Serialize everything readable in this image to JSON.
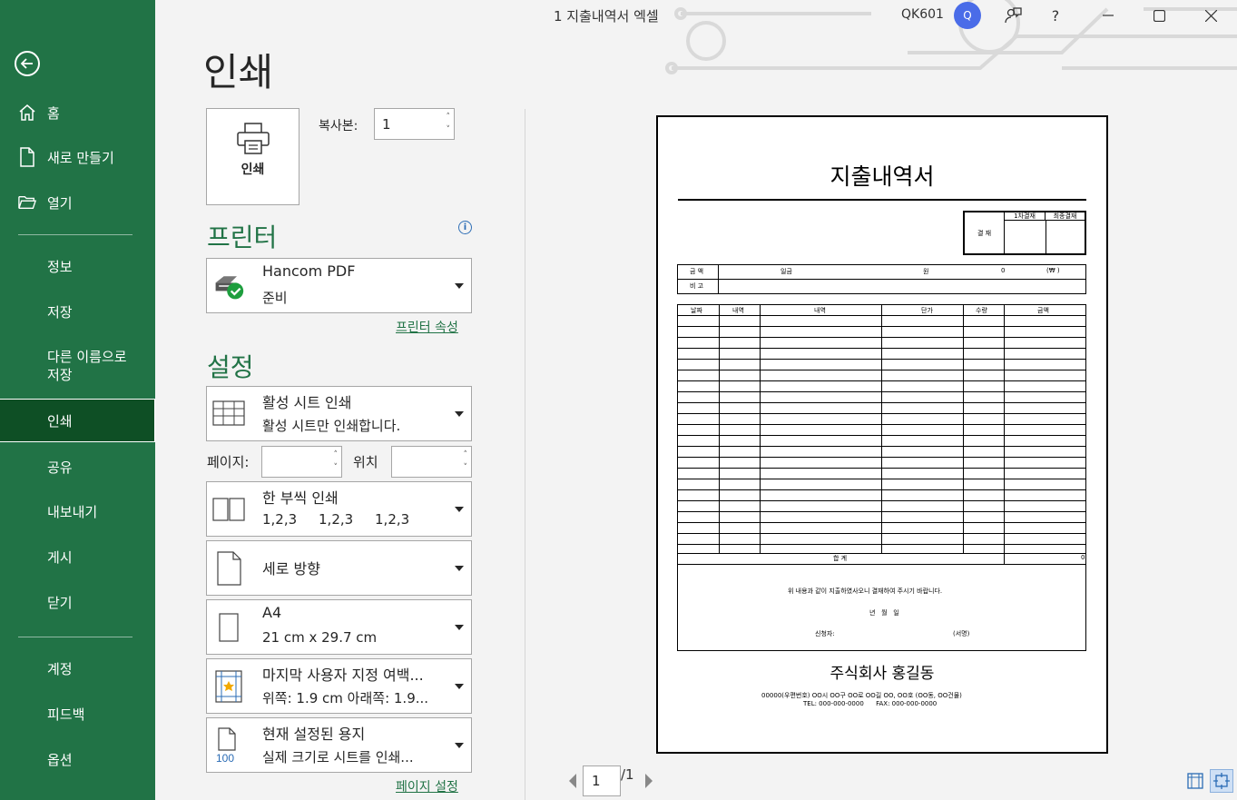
{
  "sidebar": {
    "back_label": "뒤로",
    "items": [
      {
        "label": "홈",
        "icon": "home-icon"
      },
      {
        "label": "새로 만들기",
        "icon": "new-document-icon"
      },
      {
        "label": "열기",
        "icon": "folder-open-icon"
      },
      {
        "label": "정보"
      },
      {
        "label": "저장"
      },
      {
        "label": "다른 이름으로\n저장"
      },
      {
        "label": "인쇄",
        "active": true
      },
      {
        "label": "공유"
      },
      {
        "label": "내보내기"
      },
      {
        "label": "게시"
      },
      {
        "label": "닫기"
      },
      {
        "label": "계정"
      },
      {
        "label": "피드백"
      },
      {
        "label": "옵션"
      }
    ]
  },
  "titlebar": {
    "document_title": "1 지출내역서 엑셀",
    "user_name": "QK601",
    "avatar_initial": "Q",
    "help": "?"
  },
  "print": {
    "page_title": "인쇄",
    "print_button_label": "인쇄",
    "copies_label": "복사본:",
    "copies_value": "1",
    "printer_heading": "프린터",
    "printer_name": "Hancom PDF",
    "printer_status": "준비",
    "printer_properties_link": "프린터 속성",
    "settings_heading": "설정",
    "settings": [
      {
        "line1": "활성 시트 인쇄",
        "line2": "활성 시트만 인쇄합니다.",
        "icon": "sheet-grid-icon"
      },
      {
        "line1": "한 부씩 인쇄",
        "line2": "1,2,3     1,2,3     1,2,3",
        "icon": "collate-icon"
      },
      {
        "line1": "세로 방향",
        "line2": "",
        "icon": "portrait-page-icon"
      },
      {
        "line1": "A4",
        "line2": "21 cm x 29.7 cm",
        "icon": "paper-size-icon"
      },
      {
        "line1": "마지막 사용자 지정 여백...",
        "line2": "위쪽: 1.9 cm 아래쪽: 1.9...",
        "icon": "margins-icon"
      },
      {
        "line1": "현재 설정된 용지",
        "line2": "실제 크기로 시트를 인쇄...",
        "icon": "scaling-100-icon"
      }
    ],
    "pages_label": "페이지:",
    "pages_from": "",
    "to_label": "위치",
    "pages_to": "",
    "page_setup_link": "페이지 설정"
  },
  "preview": {
    "doc_title": "지출내역서",
    "approval": {
      "stamp_label": "결 재",
      "col1": "1차결재",
      "col2": "최종결재"
    },
    "amount_label": "금 액",
    "amount_text": "일금",
    "amount_won": "원",
    "amount_value": "0",
    "amount_suffix": "(₩ )",
    "note_label": "비 고",
    "table_headers": [
      "날짜",
      "내역",
      "내역",
      "단가",
      "수량",
      "금액"
    ],
    "total_label": "합 계",
    "total_value": "0",
    "statement": "위 내용과 같이 지출하였사오니 결재하여 주시기 바랍니다.",
    "date_line": "년   월   일",
    "applicant_label": "신청자:",
    "sign_label": "(서명)",
    "company": "주식회사 홍길동",
    "address": "00000(우편번호) OO시 OO구 OO로 OO길 OO, OO호 (OO동, OO건물)",
    "contact": "TEL: 000-000-0000      FAX: 000-000-0000"
  },
  "pager": {
    "current": "1",
    "total": "/1"
  }
}
